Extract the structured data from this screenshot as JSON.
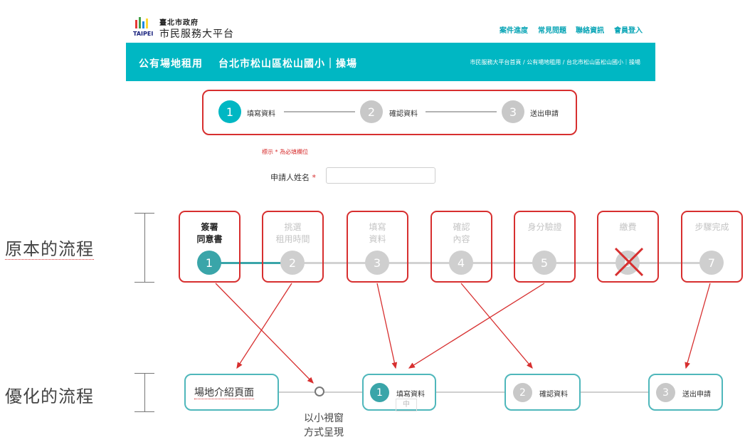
{
  "header": {
    "logo_brand": "TAIPEI",
    "logo_small": "臺北市政府",
    "logo_big": "市民服務大平台",
    "nav": [
      "案件進度",
      "常見問題",
      "聯絡資訊",
      "會員登入"
    ]
  },
  "banner": {
    "title": "公有場地租用",
    "place": "台北市松山區松山國小｜操場",
    "breadcrumb": "市民服務大平台首頁 / 公有場地租用 / 台北市松山區松山國小｜操場"
  },
  "top_stepper": {
    "steps": [
      {
        "num": "1",
        "label": "填寫資料"
      },
      {
        "num": "2",
        "label": "確認資料"
      },
      {
        "num": "3",
        "label": "送出申請"
      }
    ]
  },
  "form": {
    "required_note": "標示 * 為必填欄位",
    "name_label": "申請人姓名",
    "star": "*",
    "name_value": ""
  },
  "original": {
    "label": "原本的流程",
    "steps": [
      {
        "num": "1",
        "line1": "簽署",
        "line2": "同意書"
      },
      {
        "num": "2",
        "line1": "挑選",
        "line2": "租用時間"
      },
      {
        "num": "3",
        "line1": "填寫",
        "line2": "資料"
      },
      {
        "num": "4",
        "line1": "確認",
        "line2": "內容"
      },
      {
        "num": "5",
        "line1": "身分驗證",
        "line2": ""
      },
      {
        "num": "6",
        "line1": "繳費",
        "line2": ""
      },
      {
        "num": "7",
        "line1": "步驟完成",
        "line2": ""
      }
    ]
  },
  "optimized": {
    "label": "優化的流程",
    "intro": "場地介紹頁面",
    "steps": [
      {
        "num": "1",
        "label": "填寫資料",
        "sub": "中"
      },
      {
        "num": "2",
        "label": "確認資料"
      },
      {
        "num": "3",
        "label": "送出申請"
      }
    ],
    "popup_line1": "以小視窗",
    "popup_line2": "方式呈現"
  },
  "colors": {
    "teal": "#00b7c3",
    "accent_teal": "#3aa5a9",
    "red": "#d72f2f",
    "grey": "#cfcfcf"
  }
}
